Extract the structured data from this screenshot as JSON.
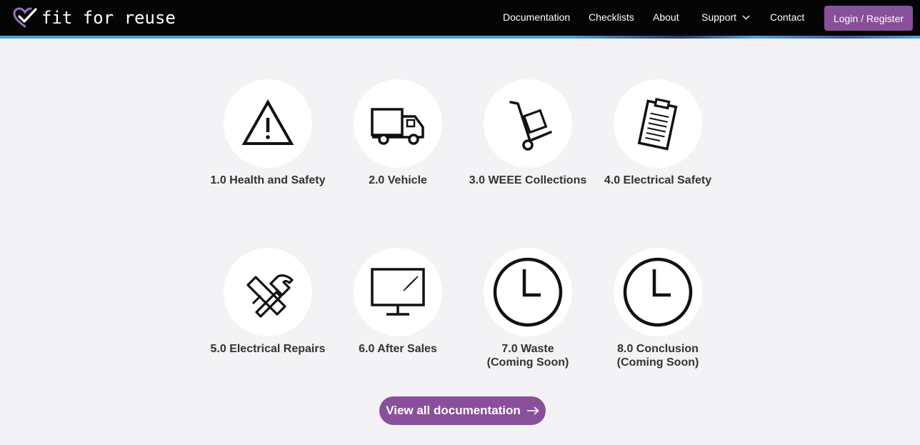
{
  "brand": {
    "name": "fit for reuse",
    "accent": "#8a4f9b",
    "nav_bg": "#050505",
    "stripe": "#4aa7dc"
  },
  "nav": {
    "items": [
      "Documentation",
      "Checklists",
      "About",
      "Support",
      "Contact"
    ],
    "support_icon": "chevron-down-icon",
    "login_label": "Login / Register"
  },
  "docs": [
    {
      "label": "1.0 Health and Safety",
      "icon": "warning-triangle-icon"
    },
    {
      "label": "2.0 Vehicle",
      "icon": "truck-icon"
    },
    {
      "label": "3.0 WEEE Collections",
      "icon": "hand-truck-icon"
    },
    {
      "label": "4.0 Electrical Safety",
      "icon": "clipboard-icon"
    },
    {
      "label": "5.0 Electrical Repairs",
      "icon": "hammer-icon"
    },
    {
      "label": "6.0 After Sales",
      "icon": "monitor-icon"
    },
    {
      "label": "7.0 Waste (Coming Soon)",
      "icon": "clock-icon"
    },
    {
      "label": "8.0 Conclusion (Coming Soon)",
      "icon": "clock-icon"
    }
  ],
  "cta": {
    "label": "View all documentation",
    "icon": "arrow-right-icon"
  }
}
